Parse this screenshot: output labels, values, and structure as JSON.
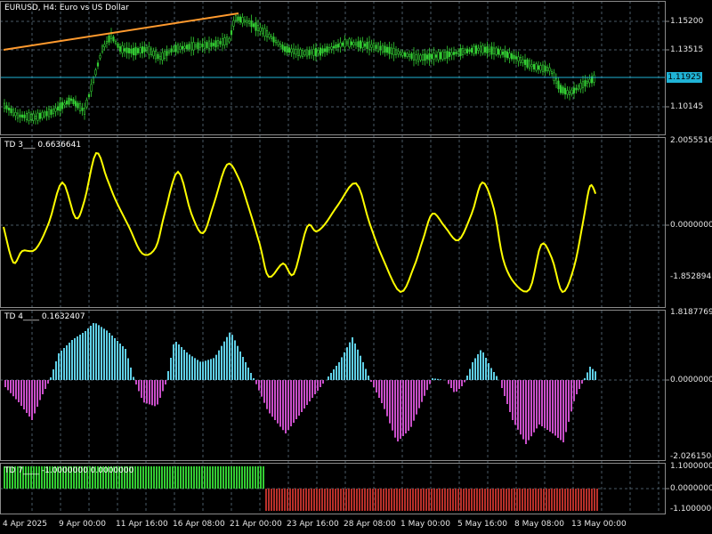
{
  "colors": {
    "background": "#000000",
    "grid": "#4a5a66",
    "border": "#8a8a8a",
    "candle": "#33cc33",
    "trendline": "#ff9a2e",
    "hline": "#1fb3d6",
    "td3_line": "#ffff00",
    "td4_positive": "#5fcfe6",
    "td4_negative": "#c84ec8",
    "td7_positive": "#33cc33",
    "td7_negative": "#b8302a"
  },
  "main": {
    "title": "EURUSD, H4:  Euro vs US Dollar",
    "current_price": "1.11925",
    "y_labels": [
      "1.15200",
      "1.13515",
      "1.10145"
    ]
  },
  "td3": {
    "title": "TD 3___  0.6636641",
    "y_labels": [
      "2.0055516",
      "0.0000000",
      "-1.8528945"
    ]
  },
  "td4": {
    "title": "TD 4____  0.1632407",
    "y_labels": [
      "1.8187769",
      "0.0000000",
      "-2.0261504"
    ]
  },
  "td7": {
    "title": "TD 7____  -1.0000000 0.0000000",
    "y_labels": [
      "1.1000000",
      "0.0000000",
      "-1.1000000"
    ]
  },
  "x_labels": [
    "4 Apr 2025",
    "9 Apr 00:00",
    "11 Apr 16:00",
    "16 Apr 08:00",
    "21 Apr 00:00",
    "23 Apr 16:00",
    "28 Apr 08:00",
    "1 May 00:00",
    "5 May 16:00",
    "8 May 08:00",
    "13 May 00:00"
  ]
}
